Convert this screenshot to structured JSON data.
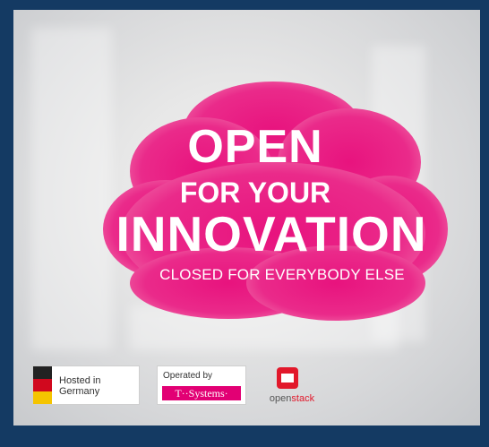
{
  "headline": {
    "line1": "OPEN",
    "line2": "FOR YOUR",
    "line3": "INNOVATION",
    "tagline": "CLOSED FOR EVERYBODY ELSE"
  },
  "badges": {
    "hosted": {
      "label": "Hosted in Germany"
    },
    "operated": {
      "label": "Operated by",
      "brand": "T··Systems·"
    },
    "openstack": {
      "text_open": "open",
      "text_stack": "stack"
    }
  },
  "colors": {
    "background": "#143a63",
    "cloud": "#e8137e",
    "tsystems_magenta": "#e20074",
    "openstack_red": "#e2182b"
  }
}
